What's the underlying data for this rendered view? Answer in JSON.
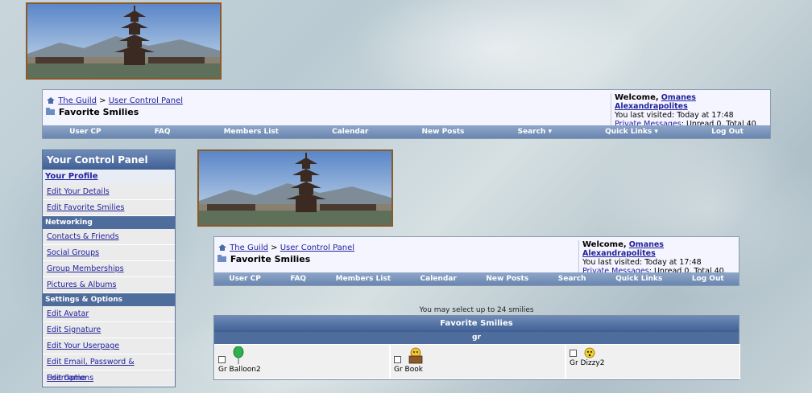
{
  "breadcrumb": {
    "home": "The Guild",
    "sep": ">",
    "section": "User Control Panel",
    "current": "Favorite Smilies"
  },
  "welcome": {
    "label": "Welcome,",
    "user": "Omanes Alexandrapolites",
    "last_visited": "You last visited: Today at 17:48",
    "pm_link": "Private Messages",
    "pm_text": ": Unread 0, Total 40."
  },
  "navbar": [
    "User CP",
    "FAQ",
    "Members List",
    "Calendar",
    "New Posts",
    "Search ▾",
    "Quick Links ▾",
    "Log Out"
  ],
  "navbar_inner": [
    "User CP",
    "FAQ",
    "Members List",
    "Calendar",
    "New Posts",
    "Search",
    "Quick Links",
    "Log Out"
  ],
  "sidebar": {
    "title": "Your Control Panel",
    "profile_header": "Your Profile",
    "profile_items": [
      "Edit Your Details",
      "Edit Favorite Smilies"
    ],
    "networking_header": "Networking",
    "networking_items": [
      "Contacts & Friends",
      "Social Groups",
      "Group Memberships",
      "Pictures & Albums"
    ],
    "settings_header": "Settings & Options",
    "settings_items": [
      "Edit Avatar",
      "Edit Signature",
      "Edit Your Userpage",
      "Edit Email, Password & Username",
      "Edit Options"
    ]
  },
  "smilies": {
    "note": "You may select up to 24 smilies",
    "title": "Favorite Smilies",
    "group": "gr",
    "items": [
      "Gr Balloon2",
      "Gr Book",
      "Gr Dizzy2"
    ]
  },
  "colors": {
    "link": "#22229c",
    "nav": "#6a86b0",
    "header": "#3f5f94"
  }
}
